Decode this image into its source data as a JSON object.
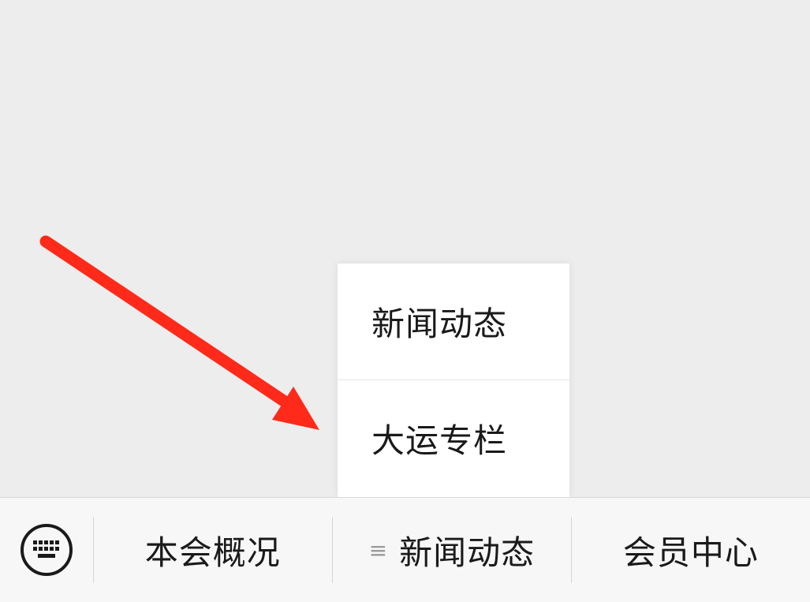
{
  "submenu": {
    "items": [
      {
        "label": "新闻动态"
      },
      {
        "label": "大运专栏"
      }
    ]
  },
  "menubar": {
    "keyboard_icon": "keyboard-icon",
    "menu_glyph": "≡",
    "tabs": [
      {
        "label": "本会概况"
      },
      {
        "label": "新闻动态"
      },
      {
        "label": "会员中心"
      }
    ]
  },
  "colors": {
    "background": "#ededed",
    "annotation_arrow": "#ff2a1a",
    "menubar_bg": "#f7f7f7"
  }
}
